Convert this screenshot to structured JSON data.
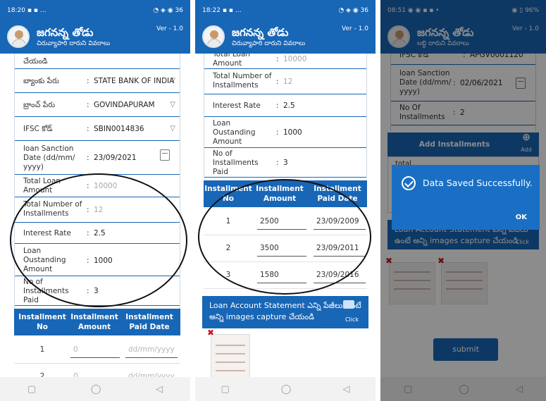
{
  "app": {
    "title": "జగనన్న తోడు",
    "subtitle": "చిరువ్యాపారి దారుని వివరాలు",
    "subtitle3": "లబ్ధి దారుని వివరాలు",
    "version": "Ver - 1.0"
  },
  "screens": [
    {
      "status": {
        "time": "18:20",
        "left_icons": "▪ ▪ …",
        "right_icons": "◔ ◈ ◉ 36"
      },
      "top_partial_label": "చేయండి",
      "fields": {
        "bank": {
          "label": "బ్యాంకు పేరు",
          "value": "STATE BANK OF INDIA"
        },
        "branch": {
          "label": "బ్రాంచ్ పేరు",
          "value": "GOVINDAPURAM"
        },
        "ifsc": {
          "label": "IFSC కోడ్",
          "value": "SBIN0014836"
        },
        "sanction": {
          "label": "loan Sanction Date (dd/mm/ yyyy)",
          "value": "23/09/2021"
        },
        "loan_amount": {
          "label": "Total Loan Amount",
          "value": "10000"
        },
        "installments": {
          "label": "Total Number of Installments",
          "value": "12"
        },
        "rate": {
          "label": "Interest Rate",
          "value": "2.5"
        },
        "outstanding": {
          "label": "Loan Oustanding Amount",
          "value": "1000"
        },
        "paid": {
          "label": "No of Installments Paid",
          "value": "3"
        }
      },
      "table_headers": {
        "no": "Installment No",
        "amount": "Installment Amount",
        "date": "Installment Paid Date"
      },
      "rows": [
        {
          "no": "1",
          "amount": "0",
          "date": "dd/mm/yyyy"
        },
        {
          "no": "2",
          "amount": "0",
          "date": "dd/mm/yyyy"
        }
      ]
    },
    {
      "status": {
        "time": "18:22",
        "left_icons": "▪ ▪ …",
        "right_icons": "◔ ◈ ◉ 36"
      },
      "fields": {
        "loan_amount": {
          "label": "Total Loan Amount",
          "value": "10000"
        },
        "installments": {
          "label": "Total Number of Installments",
          "value": "12"
        },
        "rate": {
          "label": "Interest Rate",
          "value": "2.5"
        },
        "outstanding": {
          "label": "Loan Oustanding Amount",
          "value": "1000"
        },
        "paid": {
          "label": "No of Installments Paid",
          "value": "3"
        }
      },
      "table_headers": {
        "no": "Installment No",
        "amount": "Installment Amount",
        "date": "Installment Paid Date"
      },
      "rows": [
        {
          "no": "1",
          "amount": "2500",
          "date": "23/09/2009"
        },
        {
          "no": "2",
          "amount": "3500",
          "date": "23/09/2011"
        },
        {
          "no": "3",
          "amount": "1580",
          "date": "23/09/2016"
        }
      ],
      "statement": {
        "text": "Loan Account Statement ఎన్ని పేజీలు ఉంటే అన్ని images capture చేయండి",
        "click": "Click"
      }
    },
    {
      "status": {
        "time": "08:51",
        "left_icons": "◉ ◉ ▪ ▪ •",
        "right_icons": "◉ ▯ 96%"
      },
      "fields": {
        "ifsc": {
          "label": "IFSC కోడ్",
          "value": "APGV0001120"
        },
        "sanction": {
          "label": "loan Sanction Date (dd/mm/ yyyy)",
          "value": "02/06/2021"
        },
        "installments": {
          "label": "No Of Installments",
          "value": "2"
        }
      },
      "add_installments": "Add Installments",
      "add_label": "Add",
      "total_label": "total",
      "statement": {
        "text": "Loan Account Statement ఎన్ని పేజీలు ఉంటే అన్ని images capture చేయండి",
        "click": "Click"
      },
      "dialog": {
        "message": "Data Saved Successfully.",
        "ok": "OK"
      },
      "submit": "submit"
    }
  ],
  "nav": {
    "recent": "▢",
    "home": "◯",
    "back": "◁"
  },
  "colors": {
    "primary": "#1866b6",
    "dialog": "#1a6fc4",
    "delete": "#d0121b"
  }
}
